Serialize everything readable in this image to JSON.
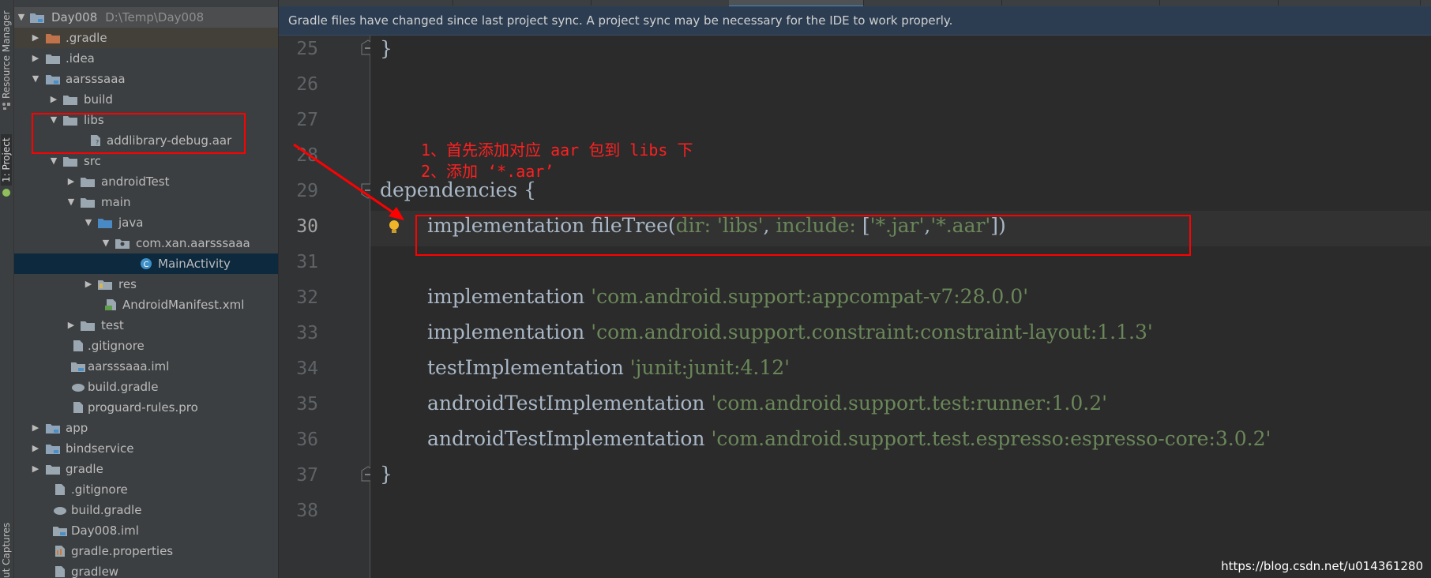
{
  "tool_strip": {
    "resource_manager": "Resource Manager",
    "project": "1: Project",
    "captures": "ut Captures"
  },
  "tree": {
    "items": [
      {
        "label": "Day008",
        "path": "D:\\Temp\\Day008",
        "icon": "module-folder-icon"
      },
      {
        "label": ".gradle",
        "icon": "folder-orange-icon"
      },
      {
        "label": ".idea",
        "icon": "folder-icon"
      },
      {
        "label": "aarsssaaa",
        "icon": "module-folder-icon"
      },
      {
        "label": "build",
        "icon": "folder-icon"
      },
      {
        "label": "libs",
        "icon": "folder-icon"
      },
      {
        "label": "addlibrary-debug.aar",
        "icon": "file-unknown-icon"
      },
      {
        "label": "src",
        "icon": "folder-icon"
      },
      {
        "label": "androidTest",
        "icon": "folder-icon"
      },
      {
        "label": "main",
        "icon": "folder-icon"
      },
      {
        "label": "java",
        "icon": "source-folder-icon"
      },
      {
        "label": "com.xan.aarsssaaa",
        "icon": "package-icon"
      },
      {
        "label": "MainActivity",
        "icon": "class-icon"
      },
      {
        "label": "res",
        "icon": "res-folder-icon"
      },
      {
        "label": "AndroidManifest.xml",
        "icon": "manifest-icon"
      },
      {
        "label": "test",
        "icon": "folder-icon"
      },
      {
        "label": ".gitignore",
        "icon": "file-icon"
      },
      {
        "label": "aarsssaaa.iml",
        "icon": "iml-icon"
      },
      {
        "label": "build.gradle",
        "icon": "gradle-icon"
      },
      {
        "label": "proguard-rules.pro",
        "icon": "file-icon"
      },
      {
        "label": "app",
        "icon": "module-folder-icon"
      },
      {
        "label": "bindservice",
        "icon": "module-folder-icon"
      },
      {
        "label": "gradle",
        "icon": "folder-icon"
      },
      {
        "label": ".gitignore",
        "icon": "file-icon"
      },
      {
        "label": "build.gradle",
        "icon": "gradle-icon"
      },
      {
        "label": "Day008.iml",
        "icon": "iml-icon"
      },
      {
        "label": "gradle.properties",
        "icon": "properties-icon"
      },
      {
        "label": "gradlew",
        "icon": "file-icon"
      }
    ]
  },
  "notice": {
    "text": "Gradle files have changed since last project sync. A project sync may be necessary for the IDE to work properly."
  },
  "editor": {
    "line_numbers": [
      "25",
      "26",
      "27",
      "28",
      "29",
      "30",
      "31",
      "32",
      "33",
      "34",
      "35",
      "36",
      "37",
      "38"
    ],
    "lines": {
      "l25": "}",
      "l29": "dependencies {",
      "l30_kw": "implementation fileTree(",
      "l30_dir": "dir: ",
      "l30_libs": "'libs'",
      "l30_comma": ", ",
      "l30_inc": "include: ",
      "l30_br1": "[",
      "l30_jar": "'*.jar'",
      "l30_c2": ",",
      "l30_aar": "'*.aar'",
      "l30_end": "])",
      "l32_kw": "implementation ",
      "l32_str": "'com.android.support:appcompat-v7:28.0.0'",
      "l33_kw": "implementation ",
      "l33_str": "'com.android.support.constraint:constraint-layout:1.1.3'",
      "l34_kw": "testImplementation ",
      "l34_str": "'junit:junit:4.12'",
      "l35_kw": "androidTestImplementation ",
      "l35_str": "'com.android.support.test:runner:1.0.2'",
      "l36_kw": "androidTestImplementation ",
      "l36_str": "'com.android.support.test.espresso:espresso-core:3.0.2'",
      "l37": "}"
    }
  },
  "annotation": {
    "line1": "1、首先添加对应 aar 包到 libs 下",
    "line2": "2、添加 ‘*.aar’"
  },
  "watermark": "https://blog.csdn.net/u014361280",
  "colors": {
    "annotation_red": "#ff0000",
    "string_green": "#6a8759",
    "selection_blue": "#0d293e"
  }
}
